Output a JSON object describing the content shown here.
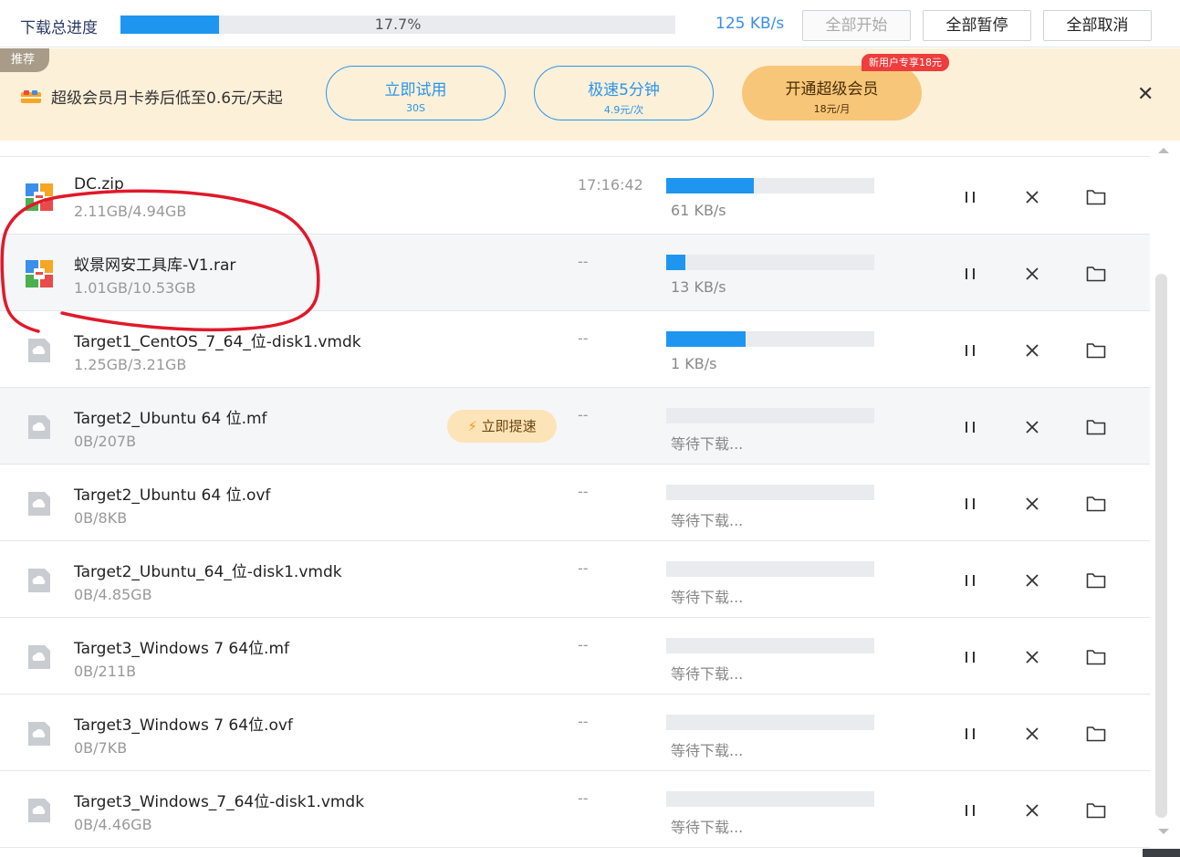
{
  "topbar": {
    "title": "下载总进度",
    "progress_percent": 17.7,
    "progress_label": "17.7%",
    "speed": "125 KB/s",
    "buttons": {
      "start_all": "全部开始",
      "pause_all": "全部暂停",
      "cancel_all": "全部取消"
    }
  },
  "promo": {
    "tag": "推荐",
    "text": "超级会员月卡券后低至0.6元/天起",
    "trial": {
      "label": "立即试用",
      "sub": "30S"
    },
    "speed5": {
      "label": "极速5分钟",
      "sub": "4.9元/次"
    },
    "vip": {
      "label": "开通超级会员",
      "sub": "18元/月",
      "badge": "新用户专享18元"
    },
    "close_icon": "close-icon"
  },
  "colors": {
    "accent": "#1e96f0",
    "promo_bg": "#fdf0d9",
    "gold": "#f7c678",
    "badge": "#ee3d3d",
    "annotation": "#e0192a"
  },
  "downloads": [
    {
      "name": "DC.zip",
      "size": "2.11GB/4.94GB",
      "time": "17:16:42",
      "progress": 0.42,
      "status": "61 KB/s",
      "icon": "archive-icon",
      "shaded": false
    },
    {
      "name": "蚁景网安工具库-V1.rar",
      "size": "1.01GB/10.53GB",
      "time": "--",
      "progress": 0.09,
      "status": "13 KB/s",
      "icon": "archive-icon",
      "shaded": true
    },
    {
      "name": "Target1_CentOS_7_64_位-disk1.vmdk",
      "size": "1.25GB/3.21GB",
      "time": "--",
      "progress": 0.38,
      "status": "1 KB/s",
      "icon": "cloud-file-icon",
      "shaded": false
    },
    {
      "name": "Target2_Ubuntu 64 位.mf",
      "size": "0B/207B",
      "time": "--",
      "progress": 0,
      "status": "等待下载...",
      "icon": "cloud-file-icon",
      "shaded": true,
      "boost": "立即提速"
    },
    {
      "name": "Target2_Ubuntu 64 位.ovf",
      "size": "0B/8KB",
      "time": "--",
      "progress": 0,
      "status": "等待下载...",
      "icon": "cloud-file-icon",
      "shaded": false
    },
    {
      "name": "Target2_Ubuntu_64_位-disk1.vmdk",
      "size": "0B/4.85GB",
      "time": "--",
      "progress": 0,
      "status": "等待下载...",
      "icon": "cloud-file-icon",
      "shaded": false
    },
    {
      "name": "Target3_Windows 7 64位.mf",
      "size": "0B/211B",
      "time": "--",
      "progress": 0,
      "status": "等待下载...",
      "icon": "cloud-file-icon",
      "shaded": false
    },
    {
      "name": "Target3_Windows 7 64位.ovf",
      "size": "0B/7KB",
      "time": "--",
      "progress": 0,
      "status": "等待下载...",
      "icon": "cloud-file-icon",
      "shaded": false
    },
    {
      "name": "Target3_Windows_7_64位-disk1.vmdk",
      "size": "0B/4.46GB",
      "time": "--",
      "progress": 0,
      "status": "等待下载...",
      "icon": "cloud-file-icon",
      "shaded": false
    }
  ]
}
